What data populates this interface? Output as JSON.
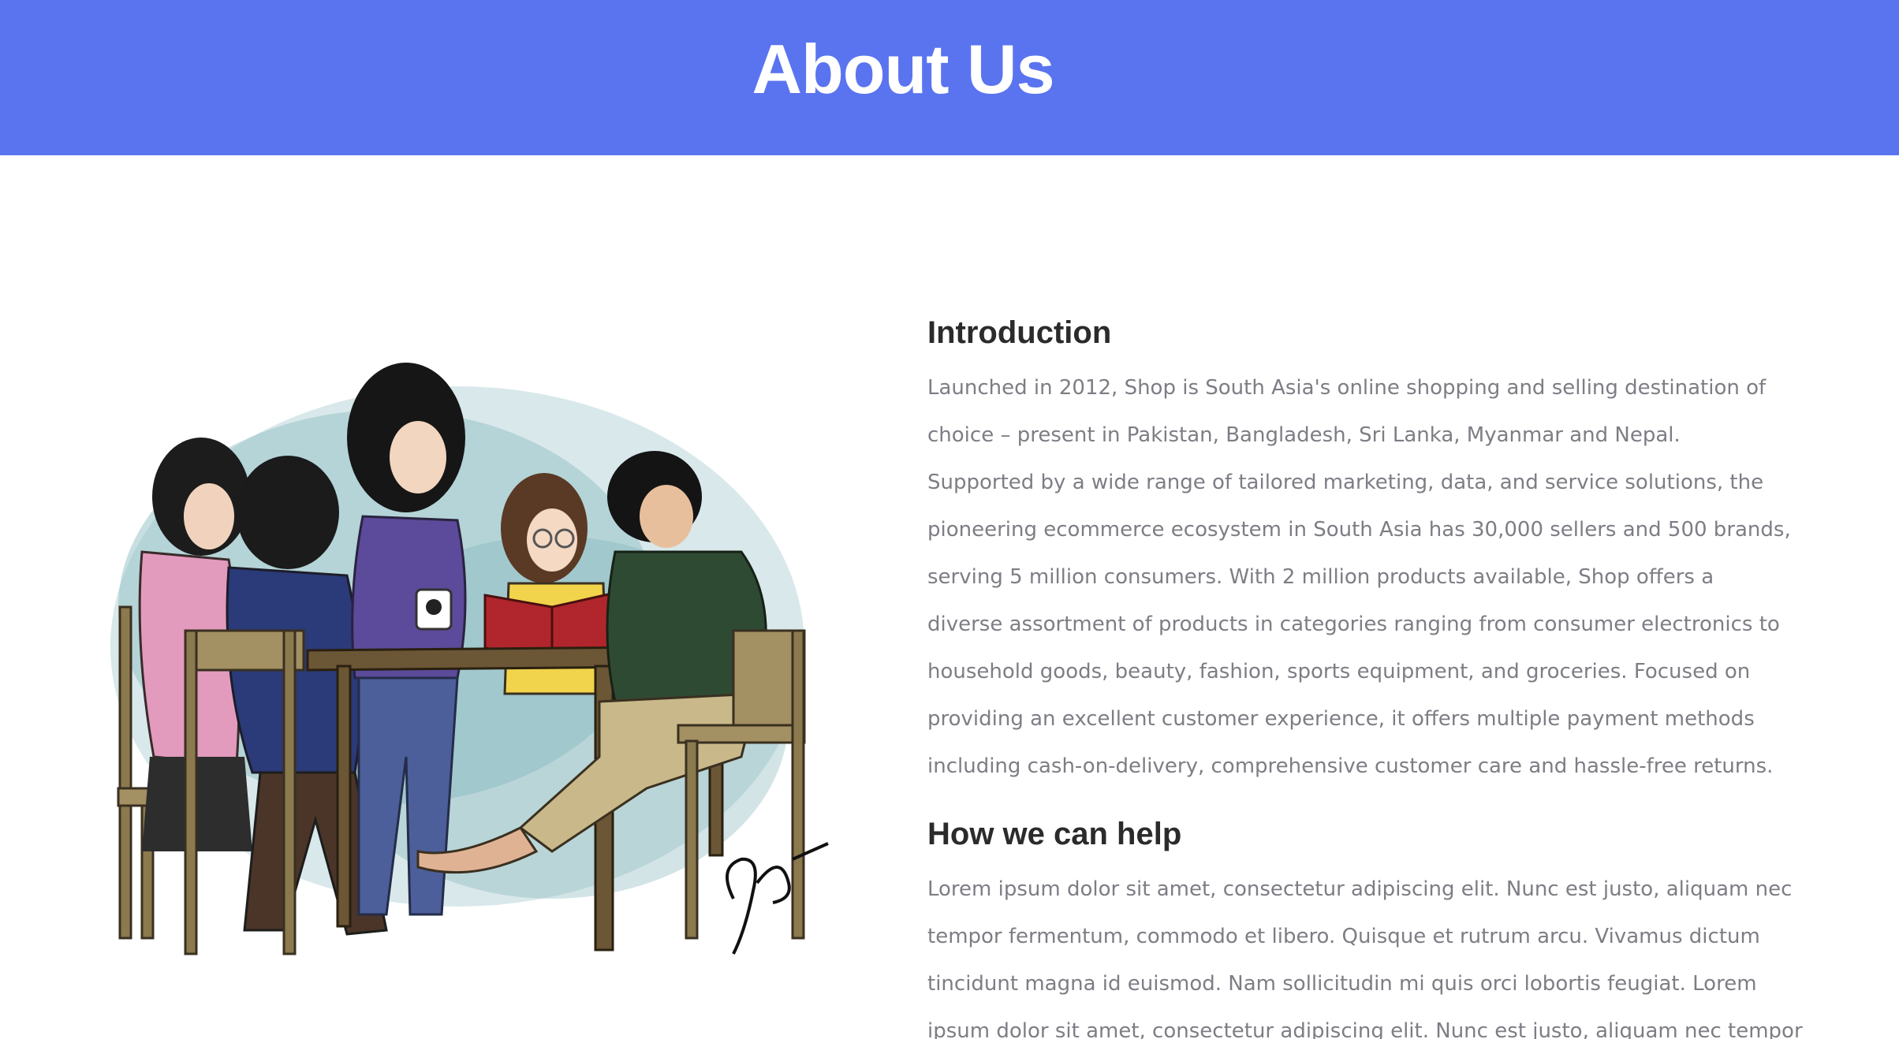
{
  "header": {
    "title": "About Us",
    "background": "#5a74f0"
  },
  "illustration": {
    "alt": "group of students studying around a table",
    "signature": "GKP"
  },
  "introduction": {
    "heading": "Introduction",
    "lines": [
      "Launched in 2012, Shop is South Asia's online shopping and selling destination of",
      "choice – present in Pakistan, Bangladesh, Sri Lanka, Myanmar and Nepal.",
      "Supported by a wide range of tailored marketing, data, and service solutions, the",
      "pioneering ecommerce ecosystem in South Asia has 30,000 sellers and 500 brands,",
      "serving 5 million consumers. With 2 million products available, Shop offers a",
      "diverse assortment of products in categories ranging from consumer electronics to",
      "household goods, beauty, fashion, sports equipment, and groceries. Focused on",
      "providing an excellent customer experience, it offers multiple payment methods",
      "including cash-on-delivery, comprehensive customer care and hassle-free returns."
    ]
  },
  "help": {
    "heading": "How we can help",
    "lines": [
      "Lorem ipsum dolor sit amet, consectetur adipiscing elit. Nunc est justo, aliquam nec",
      "tempor fermentum, commodo et libero. Quisque et rutrum arcu. Vivamus dictum",
      "tincidunt magna id euismod. Nam sollicitudin mi quis orci lobortis feugiat. Lorem",
      "ipsum dolor sit amet, consectetur adipiscing elit. Nunc est justo, aliquam nec tempor"
    ]
  }
}
